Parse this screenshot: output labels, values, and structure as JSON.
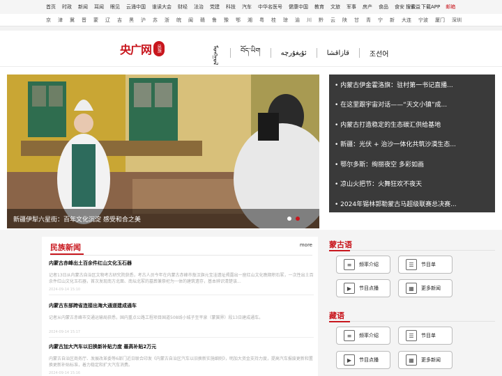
{
  "topnav": {
    "items": [
      "首页",
      "时政",
      "新闻",
      "耳闻",
      "眼见",
      "云涌中国",
      "谁读大会",
      "财经",
      "法治",
      "党建",
      "科技",
      "汽车",
      "中华名医号",
      "健康中国",
      "教育",
      "文旅",
      "军事",
      "房产",
      "食品",
      "食安",
      "公益"
    ],
    "search": "搜索",
    "app": "下载APP",
    "mail": "邮箱"
  },
  "subnav": {
    "items": [
      "京",
      "津",
      "冀",
      "晋",
      "蒙",
      "辽",
      "吉",
      "黑",
      "沪",
      "苏",
      "浙",
      "皖",
      "闽",
      "赣",
      "鲁",
      "豫",
      "鄂",
      "湘",
      "粤",
      "桂",
      "琼",
      "渝",
      "川",
      "黔",
      "云",
      "陕",
      "甘",
      "青",
      "宁",
      "新",
      "大连",
      "宁波",
      "厦门",
      "深圳"
    ]
  },
  "header": {
    "logo_text": "央广网",
    "logo_seal": "民族",
    "languages": [
      "ᠮᠣᠩᠭᠣᠯ",
      "བོད་ཡིག",
      "ئۇيغۇرچە",
      "قازاقشا",
      "조선어"
    ]
  },
  "hero": {
    "caption": "新疆伊犁六星街：百年文化沉淀 感受和合之美"
  },
  "headlines": [
    "• 内蒙古伊金霍洛旗：驻村第一书记直播...",
    "• 在这里跟宇宙对话——“天文小镇”成...",
    "• 内蒙古打造稳定的生态碳汇供给基地",
    "• 新疆：光伏 + 治沙一体化共筑沙漠生态...",
    "• 鄂尔多斯：绚丽夜空 多彩如画",
    "• 凉山火把节：火舞狂欢不夜天",
    "• 2024年锡林郭勒蒙古马超级联赛总决赛..."
  ],
  "news": {
    "title": "民族新闻",
    "more": "more",
    "articles": [
      {
        "title": "内蒙古赤峰出土百余件红山文化玉石器",
        "summary": "记者13日从内蒙古自治区文物考古研究院获悉，考古人员今年在内蒙古赤峰市敖汉旗元宝洼遗址揭露出一座红山文化晚期积石冢，一次性出土百余件红山文化玉石器，首次发现南方北面、南坛北冢的墓葬兼祭祀为一体的建筑遗存，基本辨识清楚该...",
        "date": "2024-09-14 15:10"
      },
      {
        "title": "内蒙古东部跨省连接出海大通道建成通车",
        "summary": "记者从内蒙古赤峰市交通运输局获悉，国内重点公路工程项目国道508线小城子至平泉（蒙冀界）段13日建成通车。",
        "date": "2024-09-14 15:17"
      },
      {
        "title": "内蒙古加大汽车以旧换新补贴力度 最高补贴2万元",
        "summary": "内蒙古自治区商务厅、发展改革委等6部门近日联合印发《内蒙古自治区汽车以旧换新实施细则》，明加大资金支持力度，提高汽车报废更新和置换更新补贴标准，着力稳定和扩大汽车消费。",
        "date": "2024-09-14 15:16"
      }
    ]
  },
  "mongol": {
    "title": "蒙古语",
    "buttons": [
      {
        "label": "频率介绍",
        "icon": "sliders-icon"
      },
      {
        "label": "节目单",
        "icon": "list-icon"
      },
      {
        "label": "节目点播",
        "icon": "play-icon"
      },
      {
        "label": "更多新闻",
        "icon": "grid-icon"
      }
    ]
  },
  "tibetan": {
    "title": "藏语",
    "buttons": [
      {
        "label": "频率介绍",
        "icon": "sliders-icon"
      },
      {
        "label": "节目单",
        "icon": "list-icon"
      },
      {
        "label": "节目点播",
        "icon": "play-icon"
      },
      {
        "label": "更多新闻",
        "icon": "grid-icon"
      }
    ]
  }
}
